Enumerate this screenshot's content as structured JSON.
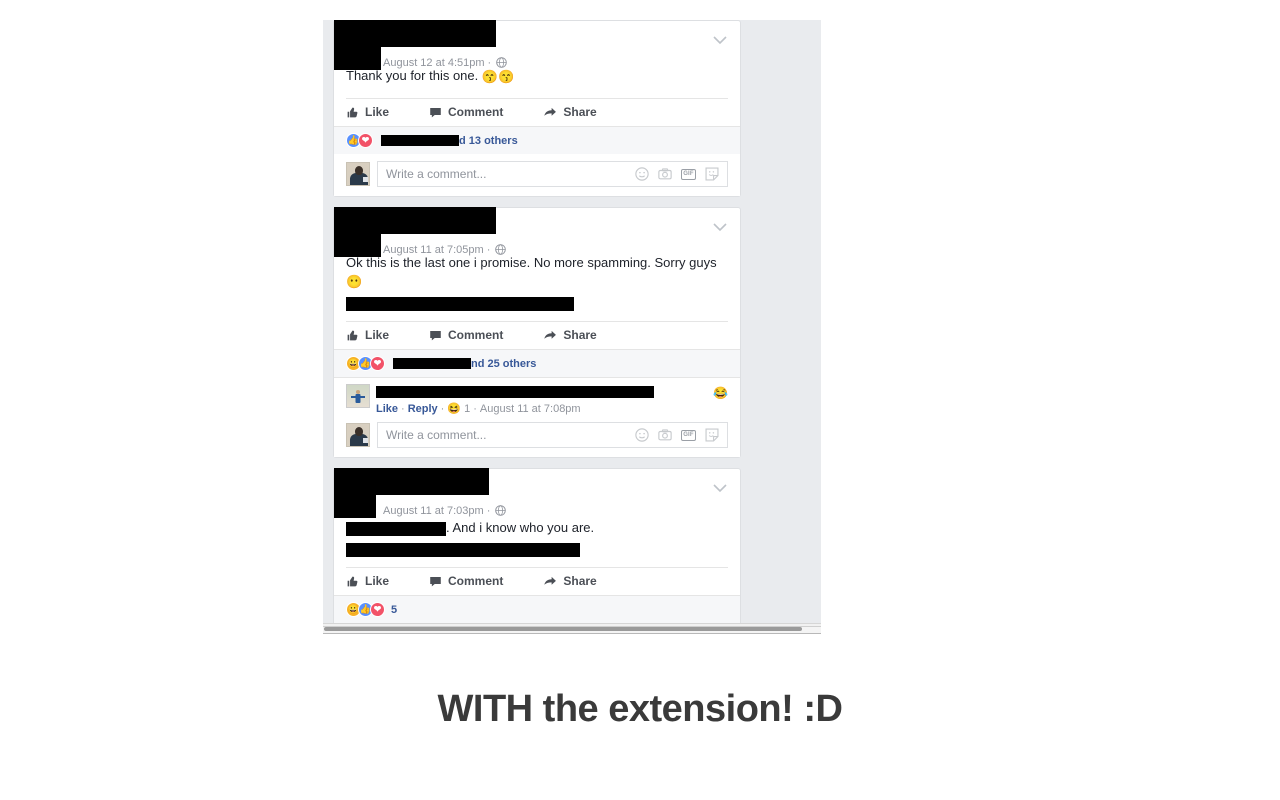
{
  "caption": "WITH the extension! :D",
  "composer": {
    "placeholder": "Write a comment...",
    "icons": [
      "emoji-icon",
      "camera-icon",
      "gif-icon",
      "sticker-icon"
    ],
    "gif_label": "GIF"
  },
  "actions": {
    "like": "Like",
    "comment": "Comment",
    "share": "Share"
  },
  "posts": [
    {
      "timestamp": "August 12 at 4:51pm",
      "privacy_icon": "globe-icon",
      "separator": "·",
      "body_text": "Thank you for this one.",
      "body_emoji": "😙😙",
      "reactions": {
        "types": [
          "like",
          "love"
        ],
        "name_redacted": true,
        "text": "d 13 others"
      },
      "comments": []
    },
    {
      "timestamp": "August 11 at 7:05pm",
      "privacy_icon": "globe-icon",
      "separator": "·",
      "body_text": "Ok this is the last one i promise. No more spamming. Sorry guys",
      "body_emoji": "😶",
      "reactions": {
        "types": [
          "haha",
          "like",
          "love"
        ],
        "name_redacted": true,
        "text": "nd 25 others"
      },
      "comments": [
        {
          "text_redacted": true,
          "emoji": "😂",
          "like_label": "Like",
          "reply_label": "Reply",
          "reaction_emoji": "😆",
          "reaction_count": "1",
          "timestamp": "August 11 at 7:08pm"
        }
      ]
    },
    {
      "timestamp": "August 11 at 7:03pm",
      "privacy_icon": "globe-icon",
      "separator": "·",
      "body_text": ". And i know who you are.",
      "body_emoji": "",
      "reactions": {
        "types": [
          "haha",
          "like",
          "love"
        ],
        "name_redacted": false,
        "text": "5"
      },
      "comments": []
    }
  ],
  "colors": {
    "page_bg": "#ffffff",
    "feed_bg": "#e9ebee",
    "card_bg": "#ffffff",
    "card_border": "#dddfe2",
    "link_blue": "#385898",
    "meta_grey": "#90949c",
    "text_dark": "#1d2129",
    "reaction_like": "#5890ff",
    "reaction_love": "#f25268",
    "reaction_haha": "#f7b125",
    "caption_color": "#3a3a3a"
  }
}
